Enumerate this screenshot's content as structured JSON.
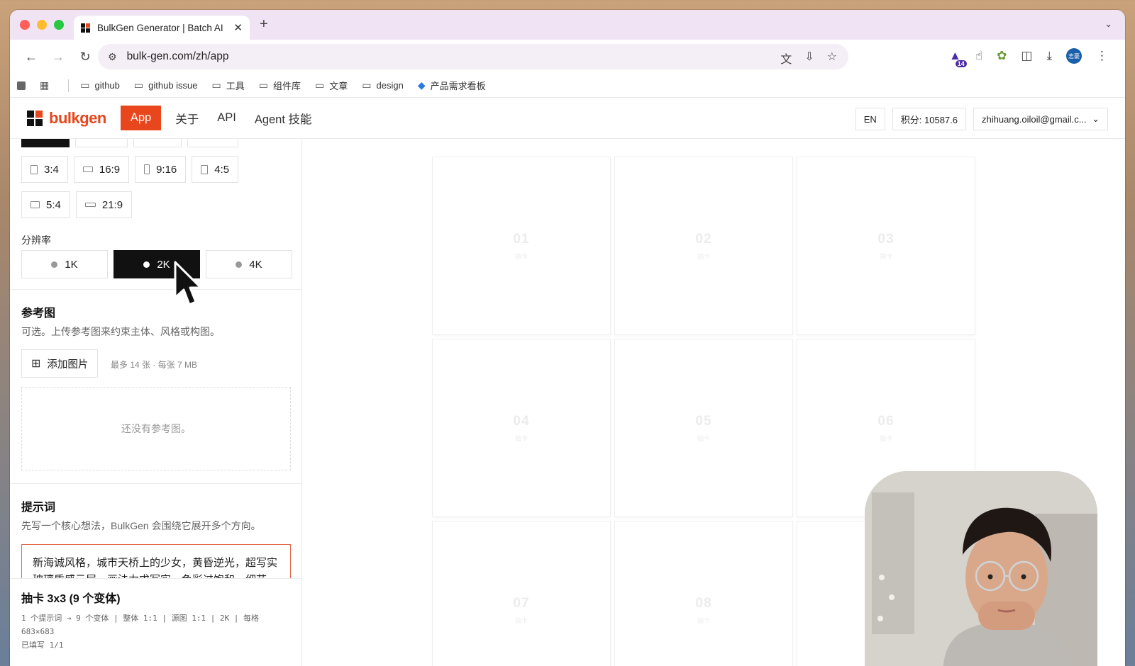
{
  "browser": {
    "tab_title": "BulkGen Generator | Batch AI",
    "tab_close": "✕",
    "new_tab": "+",
    "url": "bulk-gen.com/zh/app",
    "extension_badge": "14",
    "profile_initials": "志豪",
    "bookmarks": [
      "github",
      "github issue",
      "工具",
      "组件库",
      "文章",
      "design",
      "产品需求看板"
    ]
  },
  "app": {
    "logo": "bulkgen",
    "nav": [
      "App",
      "关于",
      "API",
      "Agent 技能"
    ],
    "lang": "EN",
    "credits": "积分: 10587.6",
    "account": "zhihuang.oiloil@gmail.c...",
    "brand_color": "#e8461c"
  },
  "sidebar": {
    "ratios_row1": [
      "3:4",
      "16:9",
      "9:16",
      "4:5"
    ],
    "ratios_row2": [
      "5:4",
      "21:9"
    ],
    "resolution_label": "分辨率",
    "resolutions": [
      "1K",
      "2K",
      "4K"
    ],
    "selected_resolution": "2K",
    "ref_title": "参考图",
    "ref_desc": "可选。上传参考图来约束主体、风格或构图。",
    "add_image": "添加图片",
    "add_limit": "最多 14 张 · 每张 7 MB",
    "ref_empty": "还没有参考图。",
    "prompt_title": "提示词",
    "prompt_desc": "先写一个核心想法，BulkGen 会围绕它展开多个方向。",
    "prompt_text": "新海诚风格，城市天桥上的少女，黄昏逆光，超写实玻璃质感云层，画法力求写实，色彩过饱和，细节",
    "summary_title": "抽卡 3x3 (9 个变体)",
    "summary_meta": "1 个提示词 → 9 个变体 | 整体 1:1 | 源图 1:1 | 2K | 每格 683×683",
    "summary_filled": "已填写 1/1"
  },
  "grid": {
    "cells": [
      {
        "num": "01",
        "label": "抽卡"
      },
      {
        "num": "02",
        "label": "抽卡"
      },
      {
        "num": "03",
        "label": "抽卡"
      },
      {
        "num": "04",
        "label": "抽卡"
      },
      {
        "num": "05",
        "label": "抽卡"
      },
      {
        "num": "06",
        "label": "抽卡"
      },
      {
        "num": "07",
        "label": "抽卡"
      },
      {
        "num": "08",
        "label": "抽卡"
      },
      {
        "num": "",
        "label": ""
      }
    ]
  }
}
